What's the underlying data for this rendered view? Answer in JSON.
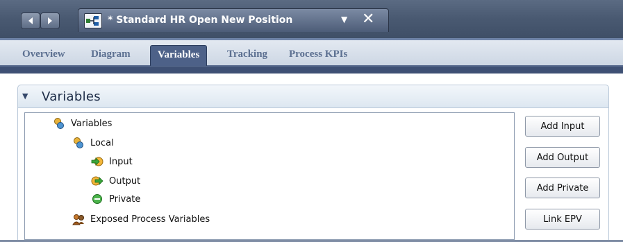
{
  "editor": {
    "title": "* Standard HR Open New Position",
    "icon": "process-diagram-icon"
  },
  "tabs": [
    {
      "label": "Overview",
      "active": false
    },
    {
      "label": "Diagram",
      "active": false
    },
    {
      "label": "Variables",
      "active": true
    },
    {
      "label": "Tracking",
      "active": false
    },
    {
      "label": "Process KPIs",
      "active": false
    }
  ],
  "section": {
    "title": "Variables",
    "tree": [
      {
        "label": "Variables",
        "icon": "variables-icon"
      },
      {
        "label": "Local",
        "icon": "variables-icon"
      },
      {
        "label": "Input",
        "icon": "input-arrow-icon"
      },
      {
        "label": "Output",
        "icon": "output-arrow-icon"
      },
      {
        "label": "Private",
        "icon": "private-icon"
      },
      {
        "label": "Exposed Process Variables",
        "icon": "exposed-variables-icon"
      }
    ]
  },
  "buttons": {
    "add_input": "Add Input",
    "add_output": "Add Output",
    "add_private": "Add Private",
    "link_epv": "Link EPV"
  },
  "colors": {
    "title_bar": "#4a5a72",
    "active_tab": "#4d6188",
    "tab_text": "#5c7091",
    "section_title": "#1b2a45"
  }
}
